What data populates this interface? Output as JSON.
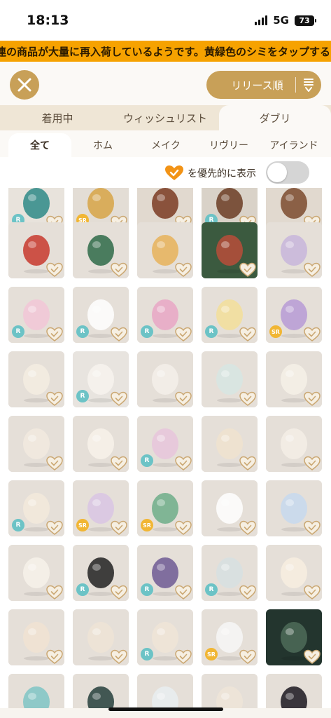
{
  "status_bar": {
    "time": "18:13",
    "network": "5G",
    "battery": "73"
  },
  "ticker": {
    "text": "連の商品が大量に再入荷しているようです。黄緑色のシミをタップする"
  },
  "toolbar": {
    "sort_label": "リリース順"
  },
  "main_tabs": [
    {
      "label": "着用中",
      "active": false
    },
    {
      "label": "ウィッシュリスト",
      "active": false
    },
    {
      "label": "ダブリ",
      "active": true
    }
  ],
  "sub_tabs": [
    {
      "label": "全て",
      "active": true
    },
    {
      "label": "ホム",
      "active": false
    },
    {
      "label": "メイク",
      "active": false
    },
    {
      "label": "リヴリー",
      "active": false
    },
    {
      "label": "アイランド",
      "active": false
    }
  ],
  "filter": {
    "label": "を優先的に表示",
    "toggle_on": false
  },
  "colors": {
    "accent": "#c8a058",
    "ticker": "#f6a200",
    "rare": "#6cc3c6",
    "super_rare": "#f1b634"
  },
  "items": [
    {
      "name": "item-bust-teal",
      "rarity": "R"
    },
    {
      "name": "item-gold-charm",
      "rarity": "SR"
    },
    {
      "name": "item-dark-panel",
      "rarity": ""
    },
    {
      "name": "item-brown-frame",
      "rarity": "R"
    },
    {
      "name": "item-wood-table",
      "rarity": ""
    },
    {
      "name": "item-santa-figure",
      "rarity": ""
    },
    {
      "name": "item-green-candy",
      "rarity": ""
    },
    {
      "name": "item-gold-tree",
      "rarity": ""
    },
    {
      "name": "item-holly-garland",
      "rarity": ""
    },
    {
      "name": "item-glass-dress",
      "rarity": ""
    },
    {
      "name": "item-pink-dress",
      "rarity": "R"
    },
    {
      "name": "item-ribbon-top",
      "rarity": "R"
    },
    {
      "name": "item-cake-stand",
      "rarity": "R"
    },
    {
      "name": "item-blonde-wig",
      "rarity": "R"
    },
    {
      "name": "item-purple-wig",
      "rarity": "SR"
    },
    {
      "name": "item-scissors",
      "rarity": ""
    },
    {
      "name": "item-lace-curtain",
      "rarity": "R"
    },
    {
      "name": "item-doily",
      "rarity": ""
    },
    {
      "name": "item-ribbon-spools",
      "rarity": ""
    },
    {
      "name": "item-pearl-strand",
      "rarity": ""
    },
    {
      "name": "item-cream-hat",
      "rarity": ""
    },
    {
      "name": "item-pearl",
      "rarity": ""
    },
    {
      "name": "item-pink-cushion",
      "rarity": "R"
    },
    {
      "name": "item-scroll",
      "rarity": ""
    },
    {
      "name": "item-pearl-garland",
      "rarity": ""
    },
    {
      "name": "item-lace-arch",
      "rarity": "R"
    },
    {
      "name": "item-sewing-machine",
      "rarity": "SR"
    },
    {
      "name": "item-green-creature",
      "rarity": "SR"
    },
    {
      "name": "item-frill-socks",
      "rarity": ""
    },
    {
      "name": "item-blue-socks",
      "rarity": ""
    },
    {
      "name": "item-white-shirt",
      "rarity": ""
    },
    {
      "name": "item-black-coat",
      "rarity": "R"
    },
    {
      "name": "item-purple-overall",
      "rarity": "R"
    },
    {
      "name": "item-glass-jar",
      "rarity": "R"
    },
    {
      "name": "item-ruffle-top",
      "rarity": ""
    },
    {
      "name": "item-head-earring",
      "rarity": ""
    },
    {
      "name": "item-head-bubbles",
      "rarity": ""
    },
    {
      "name": "item-head-blue-eyes",
      "rarity": "R"
    },
    {
      "name": "item-white-braids",
      "rarity": "SR"
    },
    {
      "name": "item-dark-window",
      "rarity": ""
    },
    {
      "name": "item-teal-ring",
      "rarity": ""
    },
    {
      "name": "item-teal-orb",
      "rarity": ""
    },
    {
      "name": "item-pale-flower",
      "rarity": ""
    },
    {
      "name": "item-small-bust",
      "rarity": ""
    },
    {
      "name": "item-dark-bell",
      "rarity": ""
    }
  ]
}
